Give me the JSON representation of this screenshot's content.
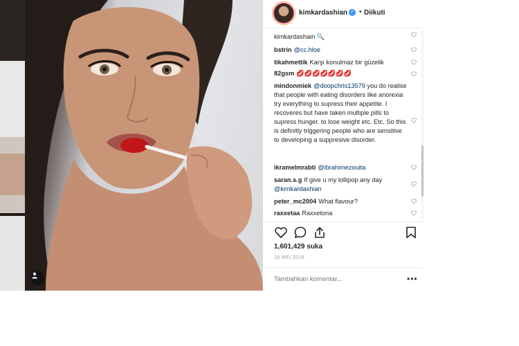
{
  "post": {
    "username": "kimkardashian",
    "follow_separator": "•",
    "follow_status": "Diikuti",
    "likes": "1,601,429 suka",
    "date": "16 MEI 2018",
    "add_comment_placeholder": "Tambahkan komentar...",
    "more_options": "•••"
  },
  "comments": [
    {
      "author": "",
      "text": "kimkardashain 🔍",
      "mention": ""
    },
    {
      "author": "bstrin",
      "text": "",
      "mention": "@cc.hloe"
    },
    {
      "author": "tikahmettik",
      "text": "Karşı konulmaz bir güzelik",
      "mention": ""
    },
    {
      "author": "82gsm",
      "text": "💋💋💋💋💋💋💋",
      "mention": ""
    },
    {
      "author": "mindonmiek",
      "mention": "@doopchris13579",
      "text": "you do realise that people with eating disorders like anorexia try everything to supress their appetite. I recoveres but have taken multiple pills to supress hunger. to lose weight etc. Etc. So this is definitly triggering people who are sensitive to developing a suppresive disorder."
    },
    {
      "author": "ikramelmrabti",
      "text": "",
      "mention": "@ibrahimezouita"
    },
    {
      "author": "saran.s.g",
      "text": "If give u my lollipop any day",
      "mention": "@kimkardashian"
    },
    {
      "author": "peter_mc2004",
      "text": "What flavour?",
      "mention": ""
    },
    {
      "author": "raxxetaa",
      "text": "Raxxetona",
      "mention": ""
    }
  ],
  "icons": [
    "user-tag-icon",
    "verified-icon",
    "heart-icon",
    "comment-icon",
    "share-icon",
    "bookmark-icon",
    "more-options-icon"
  ],
  "colors": {
    "accent": "#3897f0",
    "mention": "#003569",
    "text": "#262626",
    "muted": "#999999"
  }
}
